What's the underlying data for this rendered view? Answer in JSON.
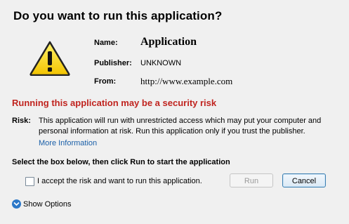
{
  "dialog": {
    "title": "Do you want to run this application?",
    "icon": "warning-triangle-icon"
  },
  "info": {
    "name_label": "Name:",
    "name_value": "Application",
    "publisher_label": "Publisher:",
    "publisher_value": "UNKNOWN",
    "from_label": "From:",
    "from_value": "http://www.example.com"
  },
  "risk": {
    "heading": "Running this application may be a security risk",
    "label": "Risk:",
    "text": "This application will run with unrestricted access which may put your computer and personal information at risk. Run this application only if you trust the publisher.",
    "more_info": "More Information"
  },
  "accept": {
    "instruction": "Select the box below, then click Run to start the application",
    "checkbox_label": "I accept the risk and want to run this application.",
    "checked": false
  },
  "buttons": {
    "run": "Run",
    "cancel": "Cancel"
  },
  "show_options": "Show Options",
  "colors": {
    "background": "#f0f0f0",
    "warning_heading": "#c0241f",
    "link": "#1a5fa8"
  }
}
